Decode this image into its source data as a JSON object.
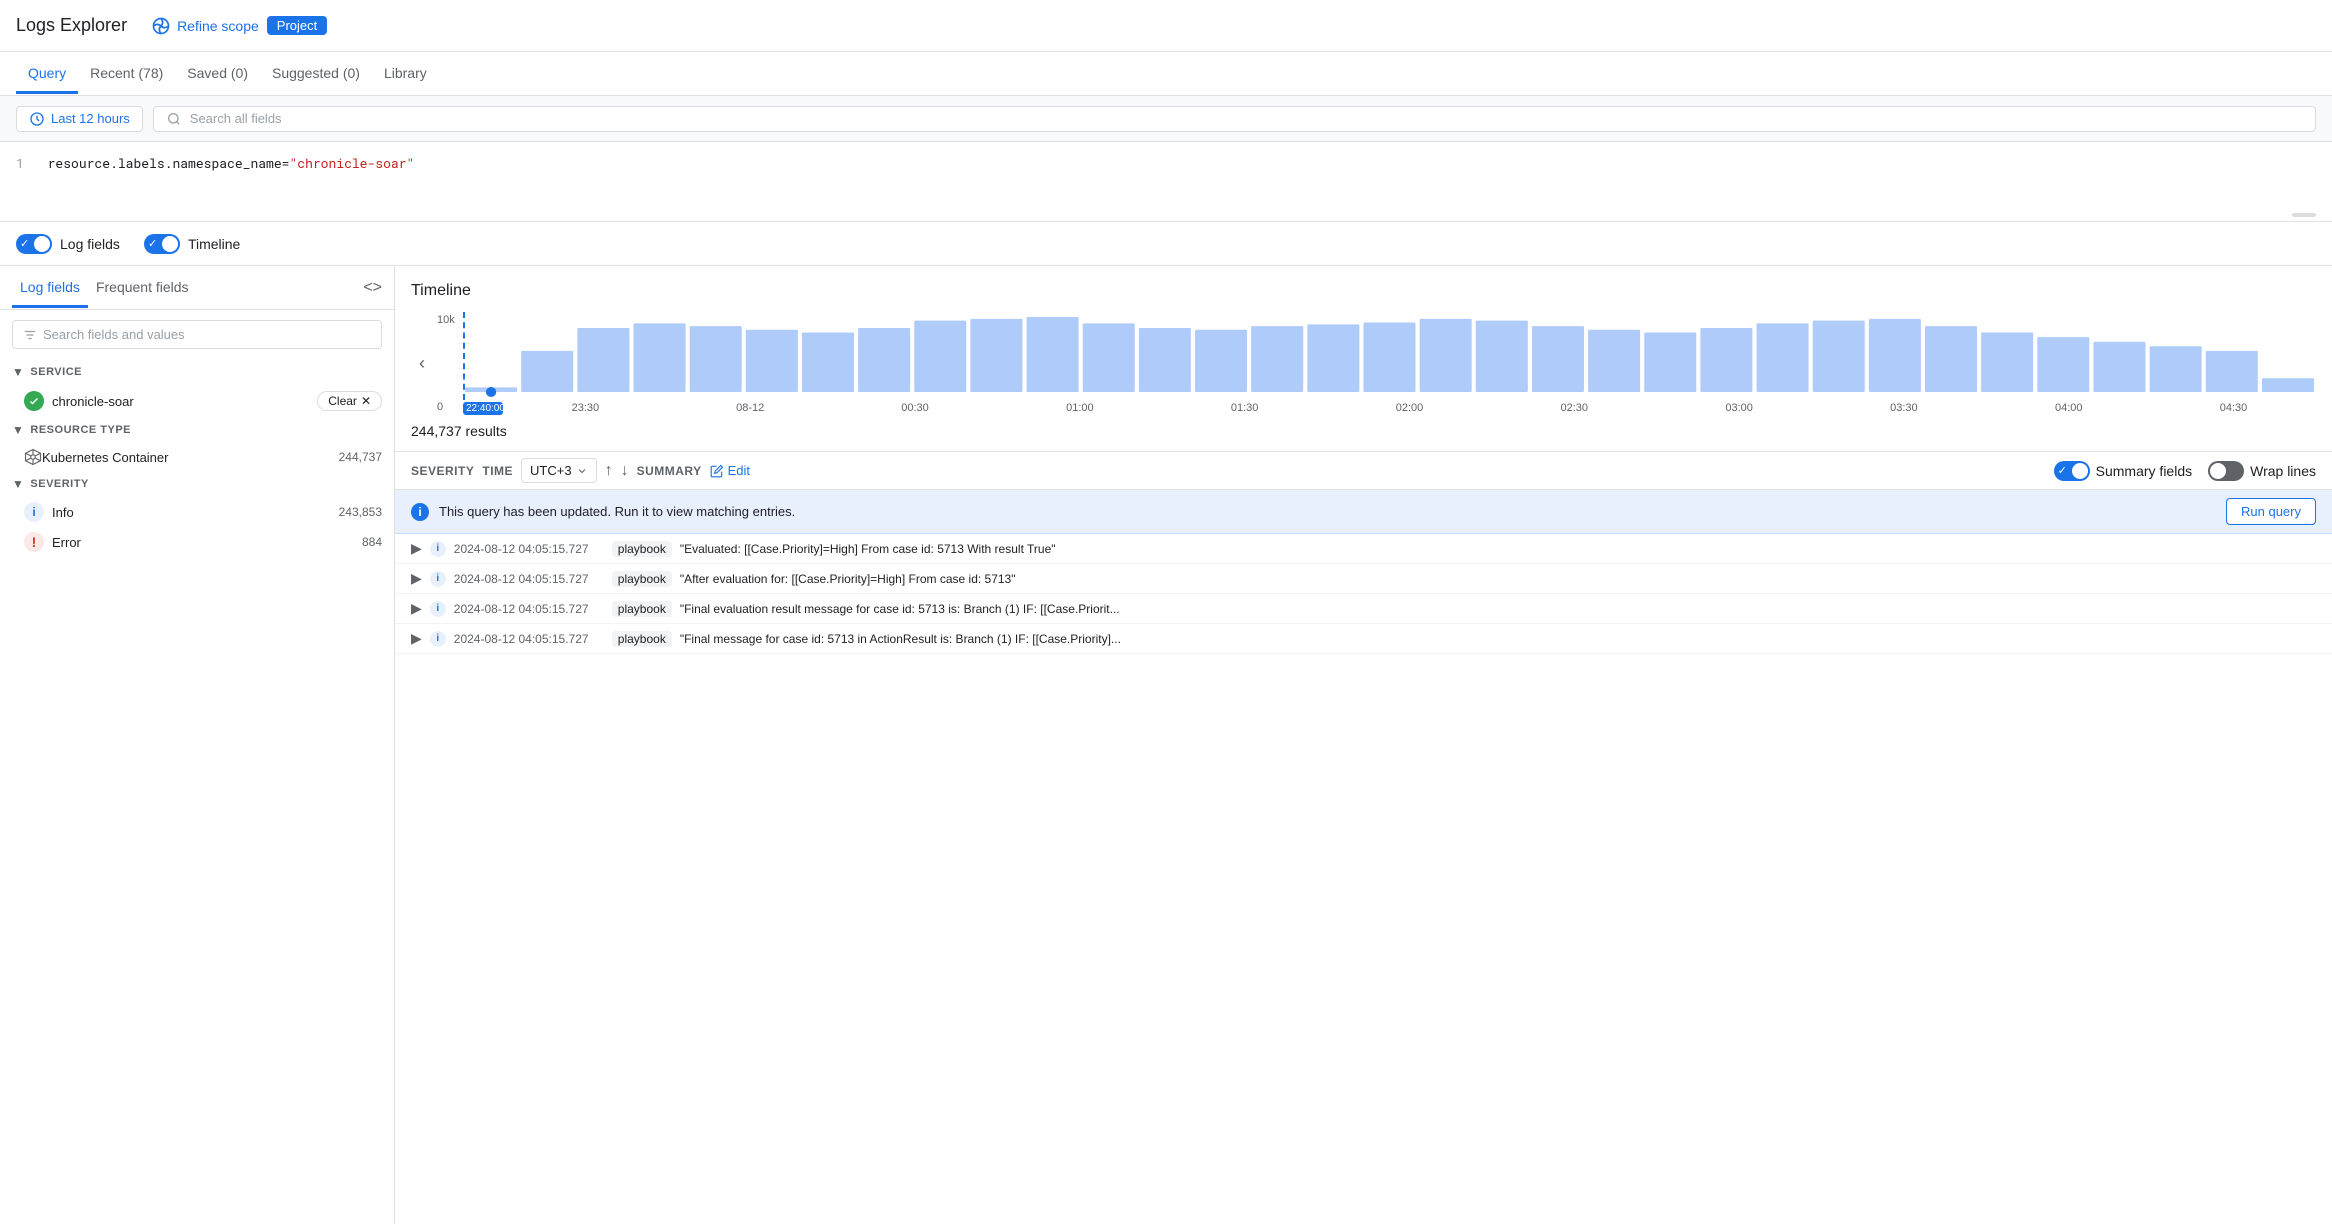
{
  "header": {
    "title": "Logs Explorer",
    "refine_scope": "Refine scope",
    "project_label": "Project"
  },
  "tabs": {
    "items": [
      {
        "label": "Query",
        "active": true
      },
      {
        "label": "Recent (78)",
        "active": false
      },
      {
        "label": "Saved (0)",
        "active": false
      },
      {
        "label": "Suggested (0)",
        "active": false
      },
      {
        "label": "Library",
        "active": false
      }
    ]
  },
  "query_bar": {
    "time_label": "Last 12 hours",
    "search_placeholder": "Search all fields"
  },
  "code_editor": {
    "line": "resource.labels.namespace_name=\"chronicle-soar\""
  },
  "toggles": {
    "log_fields_label": "Log fields",
    "timeline_label": "Timeline"
  },
  "left_panel": {
    "tab_log_fields": "Log fields",
    "tab_frequent_fields": "Frequent fields",
    "search_placeholder": "Search fields and values",
    "sections": {
      "service": {
        "label": "SERVICE",
        "items": [
          {
            "name": "chronicle-soar",
            "has_clear": true
          }
        ]
      },
      "resource_type": {
        "label": "RESOURCE TYPE",
        "items": [
          {
            "name": "Kubernetes Container",
            "count": "244,737"
          }
        ]
      },
      "severity": {
        "label": "SEVERITY",
        "items": [
          {
            "name": "Info",
            "count": "243,853"
          },
          {
            "name": "Error",
            "count": "884"
          }
        ]
      }
    },
    "clear_label": "Clear"
  },
  "timeline": {
    "title": "Timeline",
    "y_label": "10k",
    "bars": [
      5,
      45,
      70,
      75,
      72,
      68,
      65,
      70,
      78,
      80,
      82,
      75,
      70,
      68,
      72,
      74,
      76,
      80,
      78,
      72,
      68,
      65,
      70,
      75,
      78,
      80,
      72,
      65,
      60,
      55,
      50,
      45,
      15
    ],
    "x_labels": [
      "22:40:00",
      "23:30",
      "08-12",
      "00:30",
      "01:00",
      "01:30",
      "02:00",
      "02:30",
      "03:00",
      "03:30",
      "04:00",
      "04:30"
    ],
    "highlight_index": 0,
    "results_count": "244,737 results"
  },
  "results_toolbar": {
    "severity_label": "SEVERITY",
    "time_label": "TIME",
    "utc_label": "UTC+3",
    "summary_label": "SUMMARY",
    "edit_label": "Edit",
    "summary_fields_label": "Summary fields",
    "wrap_lines_label": "Wrap lines"
  },
  "info_banner": {
    "message": "This query has been updated. Run it to view matching entries.",
    "run_query_label": "Run query"
  },
  "log_rows": [
    {
      "timestamp": "2024-08-12 04:05:15.727",
      "tag": "playbook",
      "message": "\"Evaluated: [[Case.Priority]=High] From case id: 5713 With result True\""
    },
    {
      "timestamp": "2024-08-12 04:05:15.727",
      "tag": "playbook",
      "message": "\"After evaluation for: [[Case.Priority]=High] From case id: 5713\""
    },
    {
      "timestamp": "2024-08-12 04:05:15.727",
      "tag": "playbook",
      "message": "\"Final evaluation result message for case id: 5713 is: Branch (1) IF: [[Case.Priorit..."
    },
    {
      "timestamp": "2024-08-12 04:05:15.727",
      "tag": "playbook",
      "message": "\"Final message for case id: 5713 in ActionResult is: Branch (1) IF: [[Case.Priority]..."
    }
  ]
}
